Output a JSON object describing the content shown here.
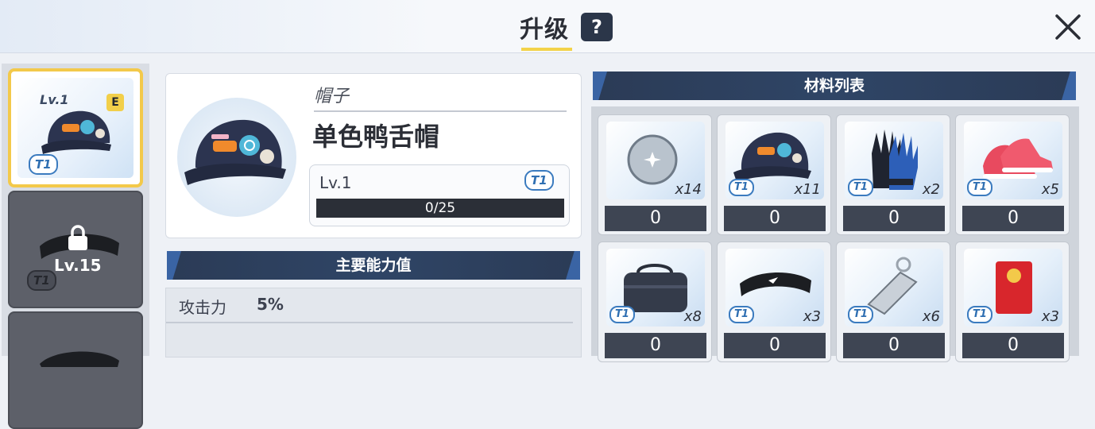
{
  "header": {
    "title": "升级",
    "help_label": "?",
    "close_icon": "close-icon"
  },
  "equipment_list": {
    "selected": {
      "level": "Lv.1",
      "rank": "E",
      "tier": "T1",
      "icon": "cap-icon"
    },
    "locked": {
      "level": "Lv.15",
      "tier": "T1",
      "icon": "lock-icon"
    }
  },
  "item": {
    "category": "帽子",
    "name": "单色鸭舌帽",
    "level": "Lv.1",
    "tier": "T1",
    "exp": "0/25",
    "exp_fraction": 0
  },
  "stats": {
    "section_title": "主要能力值",
    "rows": [
      {
        "label": "攻击力",
        "value": "5%"
      }
    ]
  },
  "materials": {
    "section_title": "材料列表",
    "items": [
      {
        "icon": "orb-icon",
        "tier": "",
        "count": "x14",
        "amount": "0"
      },
      {
        "icon": "cap-icon",
        "tier": "T1",
        "count": "x11",
        "amount": "0"
      },
      {
        "icon": "glove-icon",
        "tier": "T1",
        "count": "x2",
        "amount": "0"
      },
      {
        "icon": "sneaker-icon",
        "tier": "T1",
        "count": "x5",
        "amount": "0"
      },
      {
        "icon": "bag-icon",
        "tier": "T1",
        "count": "x8",
        "amount": "0"
      },
      {
        "icon": "headband-icon",
        "tier": "T1",
        "count": "x3",
        "amount": "0"
      },
      {
        "icon": "keychain-icon",
        "tier": "T1",
        "count": "x6",
        "amount": "0"
      },
      {
        "icon": "red-envelope-icon",
        "tier": "T1",
        "count": "x3",
        "amount": "0"
      }
    ]
  },
  "colors": {
    "accent_yellow": "#f3d34a",
    "banner_dark": "#2b3b56",
    "tier_blue": "#2f6fb2"
  }
}
